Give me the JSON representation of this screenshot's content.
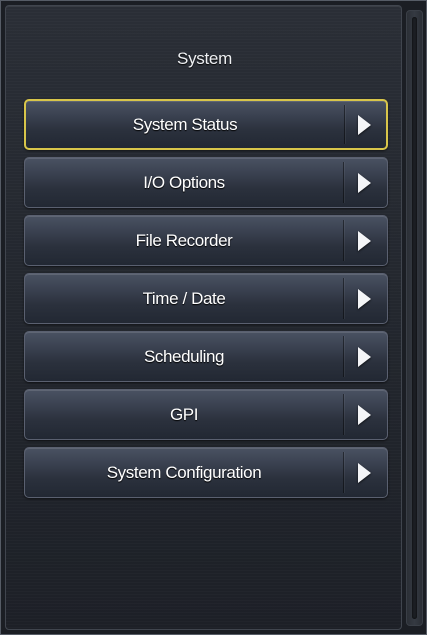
{
  "panel": {
    "title": "System"
  },
  "menu": {
    "items": [
      {
        "label": "System Status",
        "selected": true,
        "icon": "arrow-right-icon"
      },
      {
        "label": "I/O Options",
        "selected": false,
        "icon": "arrow-right-icon"
      },
      {
        "label": "File Recorder",
        "selected": false,
        "icon": "arrow-right-icon"
      },
      {
        "label": "Time / Date",
        "selected": false,
        "icon": "arrow-right-icon"
      },
      {
        "label": "Scheduling",
        "selected": false,
        "icon": "arrow-right-icon"
      },
      {
        "label": "GPI",
        "selected": false,
        "icon": "arrow-right-icon"
      },
      {
        "label": "System Configuration",
        "selected": false,
        "icon": "arrow-right-icon"
      }
    ]
  },
  "colors": {
    "selected_border": "#d8c54a",
    "button_text": "#ffffff",
    "background": "#22262d"
  }
}
